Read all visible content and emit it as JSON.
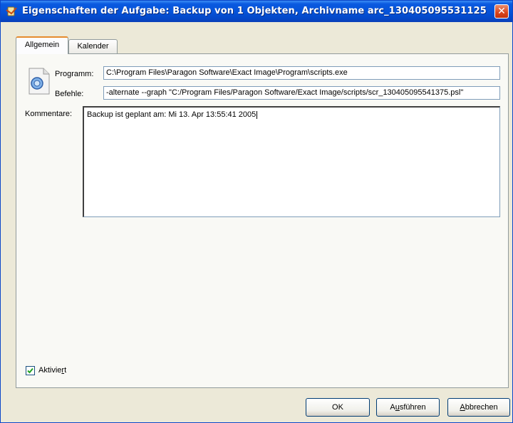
{
  "window": {
    "title": "Eigenschaften der Aufgabe: Backup von 1 Objekten, Archivname arc_130405095531125",
    "close_icon": "close-icon"
  },
  "tabs": [
    {
      "label": "Allgemein",
      "active": true
    },
    {
      "label": "Kalender",
      "active": false
    }
  ],
  "general": {
    "program_label": "Programm:",
    "program_value": "C:\\Program Files\\Paragon Software\\Exact Image\\Program\\scripts.exe",
    "command_label": "Befehle:",
    "command_value": "-alternate --graph \"C:/Program Files/Paragon Software/Exact Image/scripts/scr_130405095541375.psl\"",
    "comment_label": "Kommentare:",
    "comment_value": "Backup ist geplant am: Mi 13. Apr 13:55:41 2005",
    "active_checkbox": {
      "label_pre": "Aktivie",
      "label_mnemonic": "r",
      "label_post": "t",
      "checked": true
    }
  },
  "buttons": {
    "ok": "OK",
    "run": {
      "pre": "A",
      "mnemonic": "u",
      "post": "sführen"
    },
    "cancel": {
      "pre": "",
      "mnemonic": "A",
      "post": "bbrechen"
    }
  },
  "colors": {
    "titlebar": "#0552d8",
    "dialog_bg": "#ece9d8",
    "active_tab_accent": "#e68b2c",
    "close_button": "#d8441c"
  }
}
